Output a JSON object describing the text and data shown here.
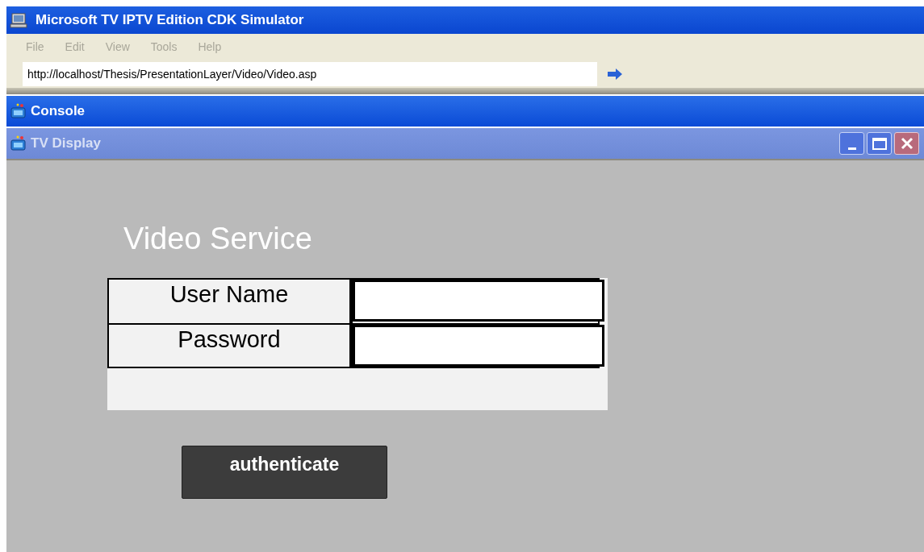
{
  "window": {
    "title": "Microsoft TV IPTV Edition CDK Simulator"
  },
  "menu": [
    {
      "label": "File",
      "disabled": true
    },
    {
      "label": "Edit",
      "disabled": true
    },
    {
      "label": "View",
      "disabled": true
    },
    {
      "label": "Tools",
      "disabled": true
    },
    {
      "label": "Help",
      "disabled": true
    }
  ],
  "address": {
    "value": "http://localhost/Thesis/PresentationLayer/Video/Video.asp"
  },
  "panes": [
    {
      "title": "Console",
      "active": true
    },
    {
      "title": "TV Display",
      "active": false
    }
  ],
  "page": {
    "heading": "Video Service",
    "fields": [
      {
        "label": "User Name"
      },
      {
        "label": "Password"
      }
    ],
    "button": "authenticate"
  }
}
